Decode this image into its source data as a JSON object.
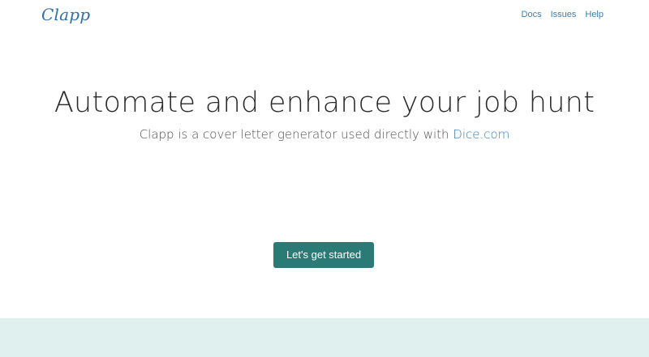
{
  "brand": {
    "name": "Clapp"
  },
  "nav": {
    "links": [
      "Docs",
      "Issues",
      "Help"
    ]
  },
  "hero": {
    "title": "Automate and enhance your job hunt",
    "subtitle_prefix": "Clapp is a cover letter generator used directly with ",
    "subtitle_link": "Dice.com"
  },
  "cta": {
    "label": "Let's get started"
  },
  "colors": {
    "brand": "#2f6fad",
    "link": "#3a7fb8",
    "button": "#2a7a75",
    "footer_band": "#dff0ee"
  }
}
